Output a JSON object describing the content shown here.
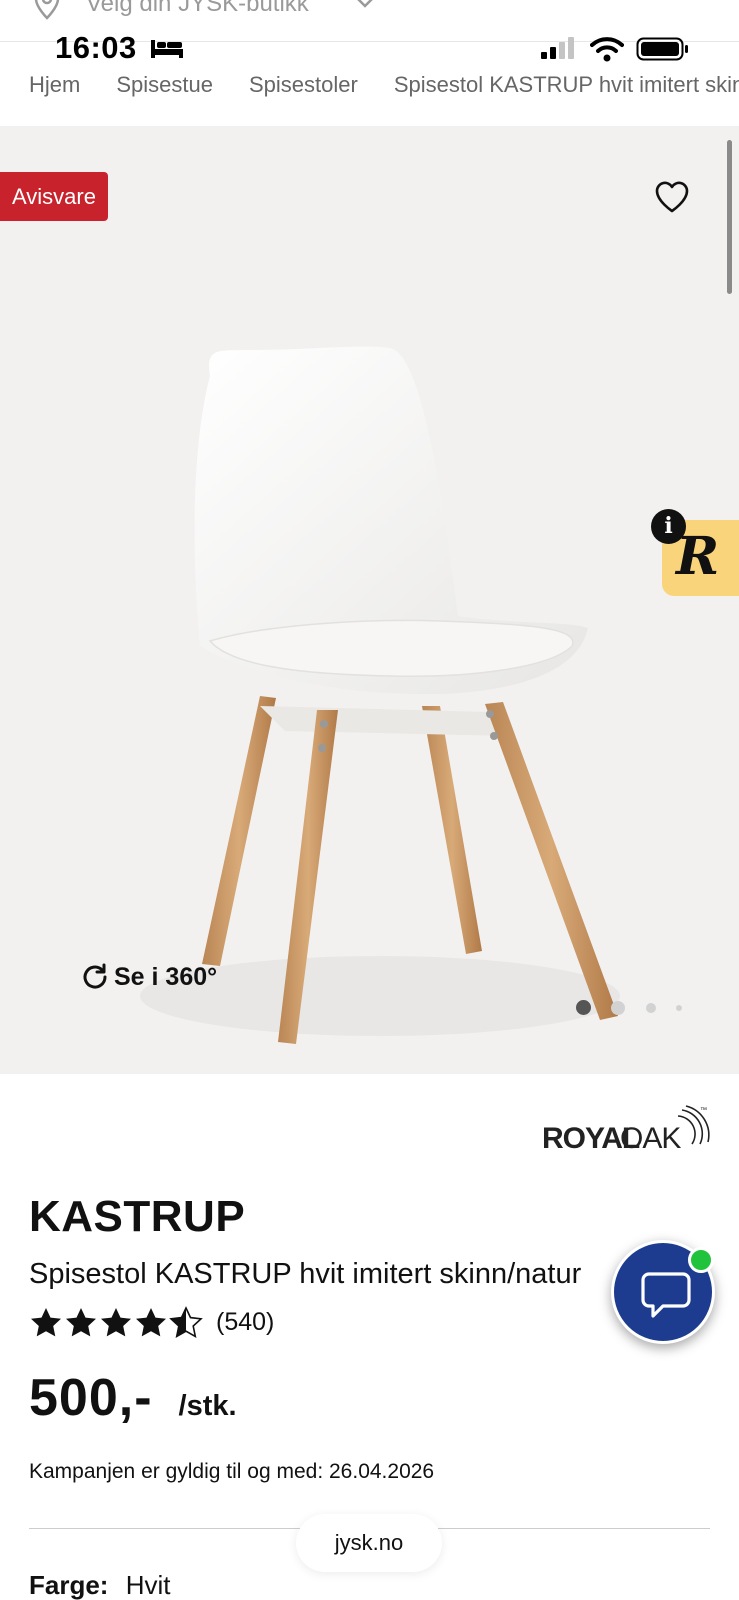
{
  "store_selector": {
    "label": "Velg din JYSK-butikk",
    "icon": "location-pin-icon"
  },
  "status_bar": {
    "time": "16:03"
  },
  "breadcrumb": [
    "Hjem",
    "Spisestue",
    "Spisestoler",
    "Spisestol KASTRUP hvit imitert skinn/natur"
  ],
  "gallery": {
    "badge": "Avisvare",
    "view_360": "Se i 360°",
    "dots": 4,
    "active_dot": 0
  },
  "widget": {
    "letter": "R",
    "info": "i"
  },
  "product": {
    "brand": "ROYALOAK",
    "brand_part1": "ROYAL",
    "brand_part2": "OAK",
    "trademark": "™",
    "name": "KASTRUP",
    "description": "Spisestol KASTRUP hvit imitert skinn/natur",
    "rating": 4.5,
    "review_count": "(540)",
    "price": "500,-",
    "unit": "/stk.",
    "campaign": "Kampanjen er gyldig til og med: 26.04.2026",
    "color_label": "Farge:",
    "color_value": "Hvit"
  },
  "url_pill": "jysk.no",
  "colors": {
    "badge": "#c8232c",
    "chat": "#1d3c8f",
    "online": "#22c33c",
    "widget": "#fad47a"
  }
}
